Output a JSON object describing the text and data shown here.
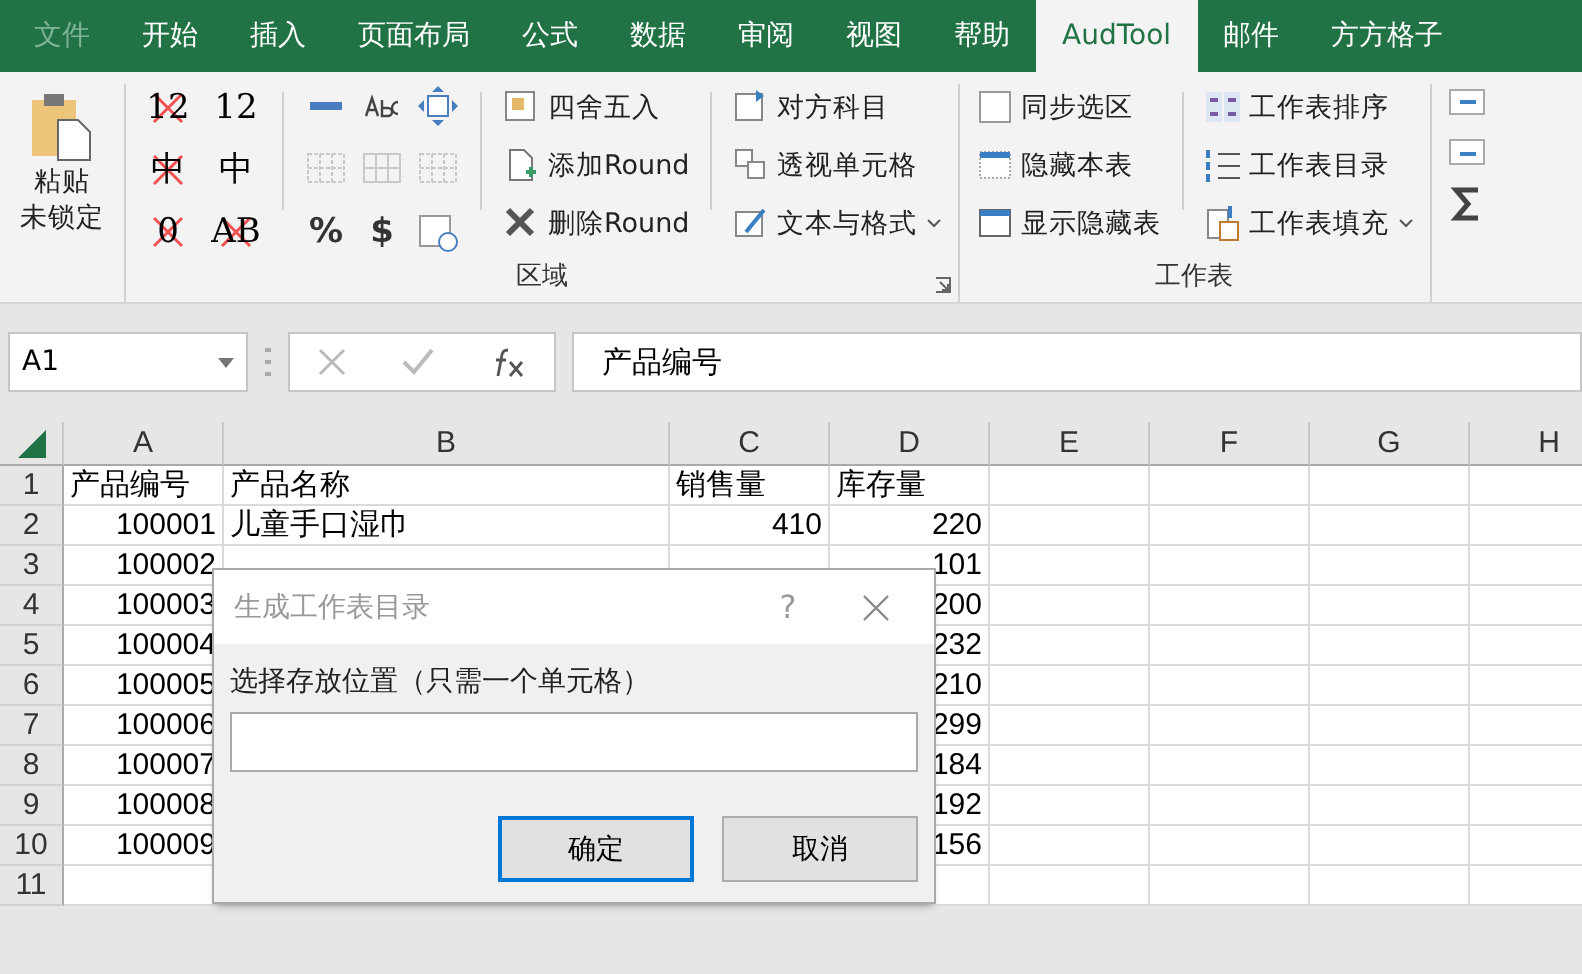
{
  "tabs": [
    {
      "label": "文件",
      "selected": false
    },
    {
      "label": "开始",
      "selected": false
    },
    {
      "label": "插入",
      "selected": false
    },
    {
      "label": "页面布局",
      "selected": false
    },
    {
      "label": "公式",
      "selected": false
    },
    {
      "label": "数据",
      "selected": false
    },
    {
      "label": "审阅",
      "selected": false
    },
    {
      "label": "视图",
      "selected": false
    },
    {
      "label": "帮助",
      "selected": false
    },
    {
      "label": "AudTool",
      "selected": true
    },
    {
      "label": "邮件",
      "selected": false
    },
    {
      "label": "方方格子",
      "selected": false
    }
  ],
  "paste": {
    "line1": "粘贴",
    "line2": "未锁定"
  },
  "region_group": {
    "label": "区域",
    "toggles": [
      {
        "text": "12",
        "crossed": true
      },
      {
        "text": "12",
        "crossed": false
      },
      {
        "text": "中",
        "crossed": true
      },
      {
        "text": "中",
        "crossed": false
      },
      {
        "text": "0",
        "crossed": true
      },
      {
        "text": "AB",
        "crossed": true
      }
    ],
    "symbols": [
      "%",
      "$"
    ],
    "round_buttons": [
      {
        "kind": "round",
        "label": "四舍五入"
      },
      {
        "kind": "add",
        "label": "添加Round"
      },
      {
        "kind": "delete",
        "label": "删除Round"
      }
    ],
    "misc_buttons": [
      {
        "kind": "account",
        "label": "对方科目",
        "dropdown": false
      },
      {
        "kind": "pivot",
        "label": "透视单元格",
        "dropdown": false
      },
      {
        "kind": "format",
        "label": "文本与格式",
        "dropdown": true
      }
    ]
  },
  "sheet_group": {
    "label": "工作表",
    "left": [
      {
        "kind": "sync",
        "label": "同步选区"
      },
      {
        "kind": "hide",
        "label": "隐藏本表"
      },
      {
        "kind": "show",
        "label": "显示隐藏表"
      }
    ],
    "right": [
      {
        "kind": "sort",
        "label": "工作表排序",
        "dropdown": false
      },
      {
        "kind": "toc",
        "label": "工作表目录",
        "dropdown": false
      },
      {
        "kind": "fill",
        "label": "工作表填充",
        "dropdown": true
      }
    ]
  },
  "formula_bar": {
    "name_box": "A1",
    "content": "产品编号"
  },
  "sheet": {
    "columns": [
      "A",
      "B",
      "C",
      "D",
      "E",
      "F",
      "G",
      "H"
    ],
    "rows": [
      {
        "number": "1",
        "cells": [
          "产品编号",
          "产品名称",
          "销售量",
          "库存量"
        ]
      },
      {
        "number": "2",
        "cells": [
          "100001",
          "儿童手口湿巾",
          "410",
          "220"
        ]
      },
      {
        "number": "3",
        "cells": [
          "100002",
          "",
          "",
          "101"
        ]
      },
      {
        "number": "4",
        "cells": [
          "100003",
          "",
          "",
          "200"
        ]
      },
      {
        "number": "5",
        "cells": [
          "100004",
          "",
          "",
          "232"
        ]
      },
      {
        "number": "6",
        "cells": [
          "100005",
          "",
          "",
          "210"
        ]
      },
      {
        "number": "7",
        "cells": [
          "100006",
          "",
          "",
          "299"
        ]
      },
      {
        "number": "8",
        "cells": [
          "100007",
          "",
          "",
          "184"
        ]
      },
      {
        "number": "9",
        "cells": [
          "100008",
          "",
          "",
          "192"
        ]
      },
      {
        "number": "10",
        "cells": [
          "100009",
          "",
          "",
          "156"
        ]
      },
      {
        "number": "11",
        "cells": [
          "",
          "",
          "",
          ""
        ]
      }
    ]
  },
  "dialog": {
    "title": "生成工作表目录",
    "help": "?",
    "prompt": "选择存放位置（只需一个单元格）",
    "ok": "确定",
    "cancel": "取消"
  }
}
